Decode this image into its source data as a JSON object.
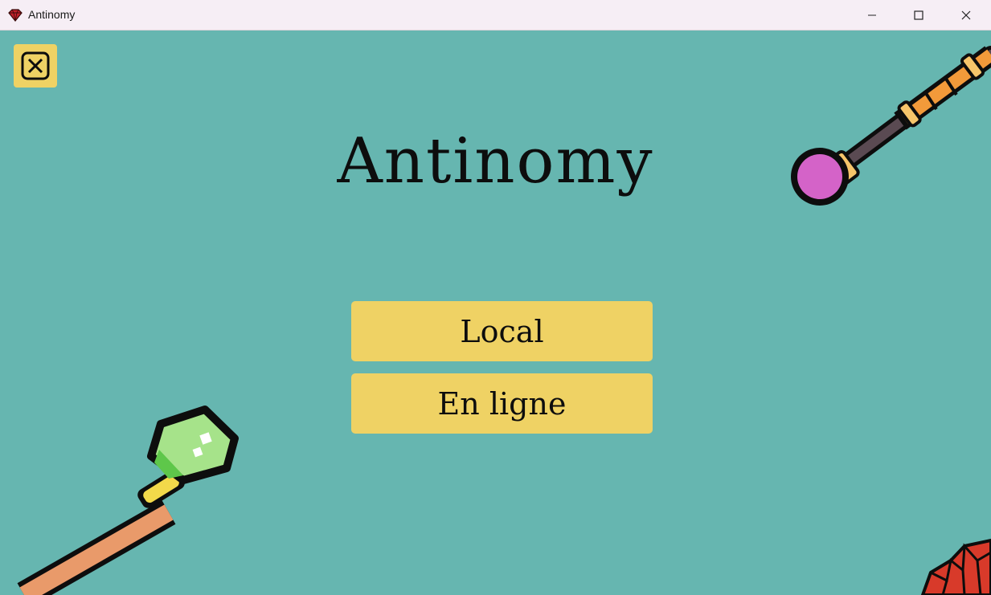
{
  "window": {
    "title": "Antinomy",
    "app_icon": "red-gem-icon",
    "controls": [
      "minimize-icon",
      "maximize-icon",
      "close-icon"
    ]
  },
  "game": {
    "title": "Antinomy",
    "quit_icon": "close-box-icon",
    "buttons": {
      "local": "Local",
      "online": "En ligne"
    }
  },
  "colors": {
    "background": "#66b6b0",
    "button": "#efd264",
    "text": "#0d0d0d"
  }
}
